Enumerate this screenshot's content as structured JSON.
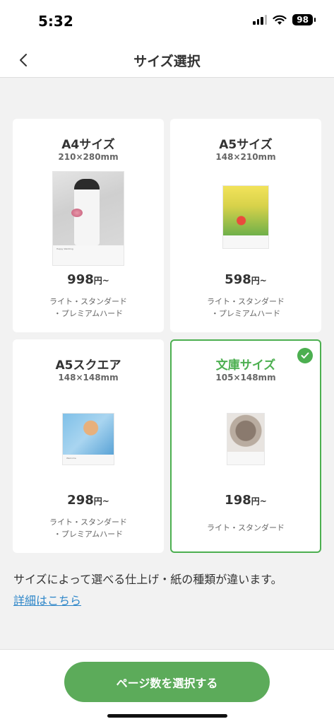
{
  "status_bar": {
    "time": "5:32",
    "battery": "98"
  },
  "nav": {
    "title": "サイズ選択",
    "back_icon": "chevron-left-icon"
  },
  "cards": [
    {
      "name": "A4サイズ",
      "dimensions": "210×280mm",
      "price": "998",
      "price_unit": "円~",
      "finish_lines": [
        "ライト・スタンダード",
        "・プレミアムハード"
      ],
      "thumb_caption": "Happy Wedding",
      "selected": false
    },
    {
      "name": "A5サイズ",
      "dimensions": "148×210mm",
      "price": "598",
      "price_unit": "円~",
      "finish_lines": [
        "ライト・スタンダード",
        "・プレミアムハード"
      ],
      "thumb_caption": "",
      "selected": false
    },
    {
      "name": "A5スクエア",
      "dimensions": "148×148mm",
      "price": "298",
      "price_unit": "円~",
      "finish_lines": [
        "ライト・スタンダード",
        "・プレミアムハード"
      ],
      "thumb_caption": "Welcome",
      "selected": false
    },
    {
      "name": "文庫サイズ",
      "dimensions": "105×148mm",
      "price": "198",
      "price_unit": "円~",
      "finish_lines": [
        "ライト・スタンダード"
      ],
      "thumb_caption": "",
      "selected": true
    }
  ],
  "note": "サイズによって選べる仕上げ・紙の種類が違います。",
  "detail_link": "詳細はこちら",
  "primary_button": "ページ数を選択する",
  "colors": {
    "accent": "#5cab5a",
    "selected_border": "#4caf50",
    "link": "#2f87c9"
  }
}
